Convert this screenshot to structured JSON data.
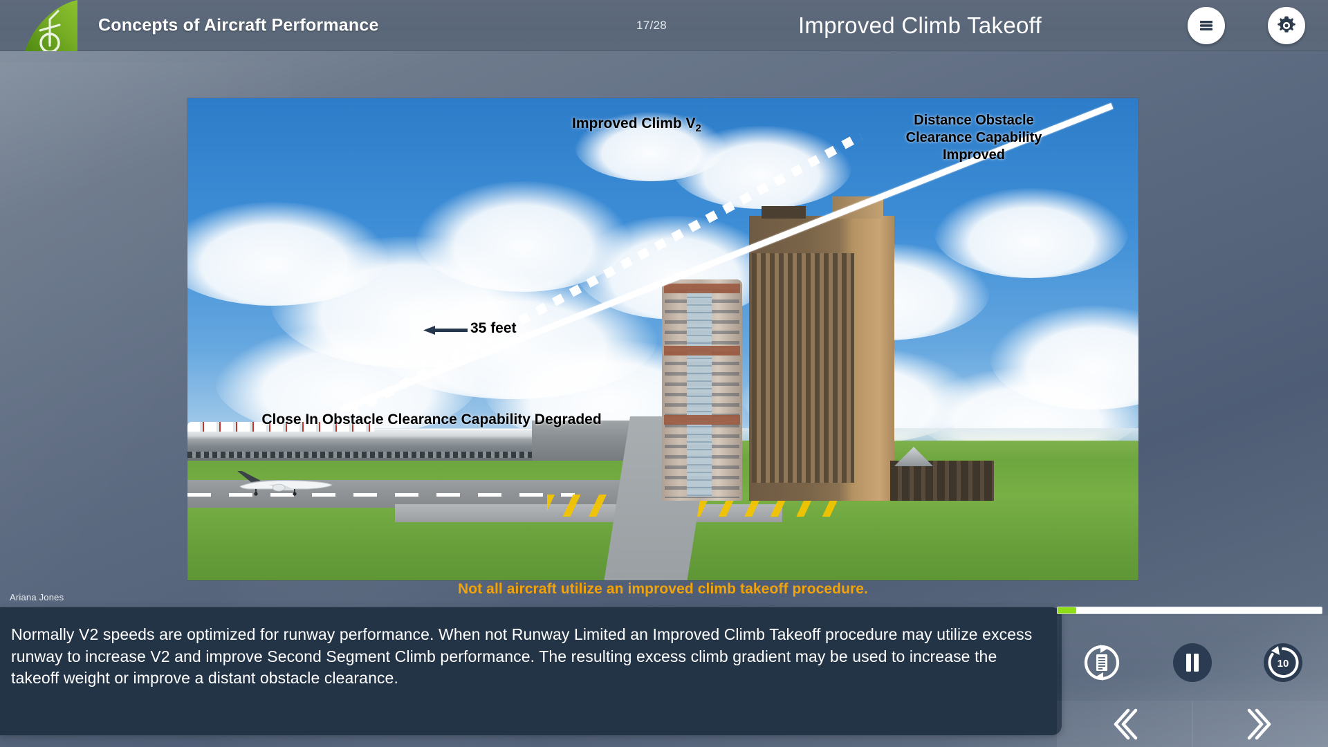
{
  "header": {
    "course_title": "Concepts of Aircraft Performance",
    "page_counter": "17/28",
    "slide_title": "Improved Climb Takeoff",
    "logo_name": "airline-tail-logo",
    "menu_icon": "hamburger-menu-icon",
    "settings_icon": "gear-icon"
  },
  "slide": {
    "annotations": {
      "improved_climb_v2": "Improved Climb V",
      "improved_climb_v2_sub": "2",
      "distance_obstacle": "Distance Obstacle Clearance Capability Improved",
      "height_callout": "35 feet",
      "close_in": "Close In Obstacle Clearance Capability Degraded"
    },
    "caption": "Not all aircraft utilize an improved climb takeoff procedure."
  },
  "presenter": {
    "name": "Ariana Jones"
  },
  "subtitle": {
    "text": "Normally V2 speeds are optimized for runway performance. When not Runway Limited an Improved Climb Takeoff procedure may utilize excess runway to increase V2 and improve Second Segment Climb performance. The resulting excess climb gradient may be used to increase the takeoff weight or improve a distant obstacle clearance."
  },
  "player": {
    "progress_percent": 7,
    "progress_fill_color": "#8fdc18",
    "transcript_label": "transcript-replay",
    "pause_label": "pause",
    "rewind_label": "rewind-10-seconds",
    "rewind_seconds": "10",
    "prev_label": "previous-slide",
    "next_label": "next-slide"
  },
  "colors": {
    "header_bg": "#5c6a7c",
    "subtitle_bg": "#243447",
    "caption_orange": "#f0a30a",
    "accent_green": "#8fdc18",
    "logo_green": "#6aa521"
  }
}
